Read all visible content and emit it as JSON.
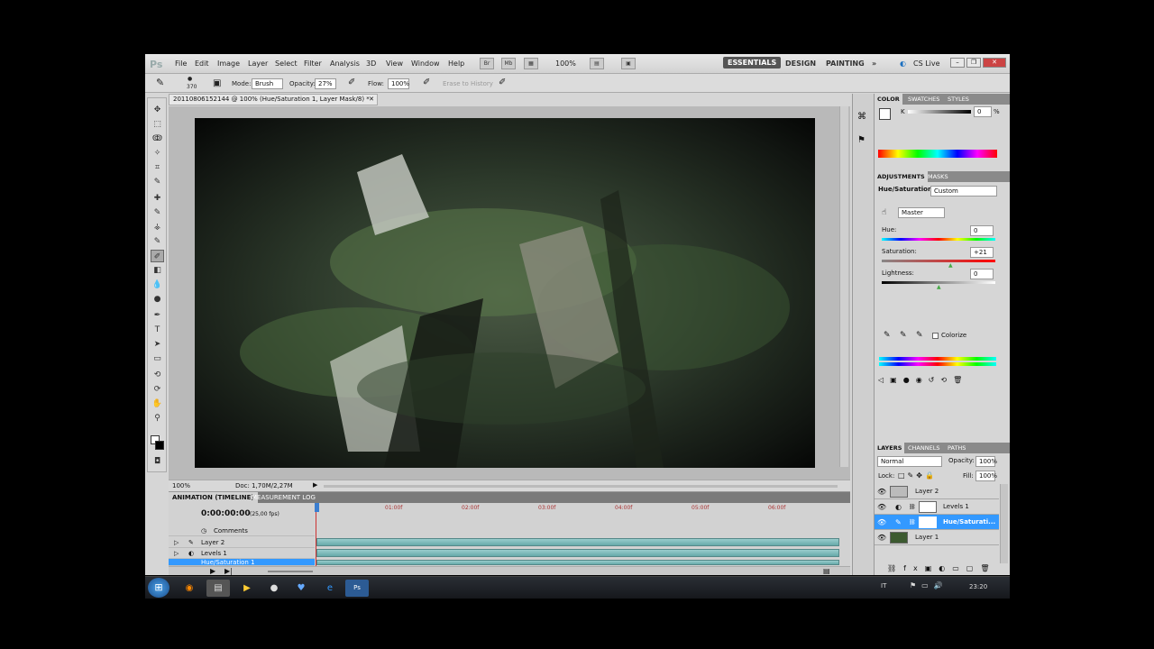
{
  "menubar": {
    "logo": "Ps",
    "menus": [
      "File",
      "Edit",
      "Image",
      "Layer",
      "Select",
      "Filter",
      "Analysis",
      "3D",
      "View",
      "Window",
      "Help"
    ],
    "zoom": "100%",
    "workspaces": [
      "ESSENTIALS",
      "DESIGN",
      "PAINTING"
    ],
    "cslive": "CS Live"
  },
  "options": {
    "brush_size": "370",
    "mode_label": "Mode:",
    "mode_value": "Brush",
    "opacity_label": "Opacity:",
    "opacity_value": "27%",
    "flow_label": "Flow:",
    "flow_value": "100%",
    "erase_history": "Erase to History"
  },
  "document": {
    "tab_title": "20110806152144 @ 100% (Hue/Saturation 1, Layer Mask/8) *",
    "status_zoom": "100%",
    "status_doc": "Doc: 1,70M/2,27M"
  },
  "timeline": {
    "tabs": [
      "ANIMATION (TIMELINE)",
      "MEASUREMENT LOG"
    ],
    "timecode": "0:00:00:00",
    "fps": "(25,00 fps)",
    "markers": [
      "01:00f",
      "02:00f",
      "03:00f",
      "04:00f",
      "05:00f",
      "06:00f"
    ],
    "rows": [
      "Comments",
      "Layer 2",
      "Levels 1",
      "Hue/Saturation 1"
    ]
  },
  "color_panel": {
    "tabs": [
      "COLOR",
      "SWATCHES",
      "STYLES"
    ],
    "channel": "K",
    "value": "0",
    "unit": "%"
  },
  "adjustments": {
    "tabs": [
      "ADJUSTMENTS",
      "MASKS"
    ],
    "title": "Hue/Saturation",
    "preset": "Custom",
    "range": "Master",
    "hue_label": "Hue:",
    "hue_value": "0",
    "saturation_label": "Saturation:",
    "saturation_value": "+21",
    "lightness_label": "Lightness:",
    "lightness_value": "0",
    "colorize": "Colorize"
  },
  "layers_panel": {
    "tabs": [
      "LAYERS",
      "CHANNELS",
      "PATHS"
    ],
    "blend_mode": "Normal",
    "opacity_label": "Opacity:",
    "opacity_value": "100%",
    "lock_label": "Lock:",
    "fill_label": "Fill:",
    "fill_value": "100%",
    "layers": [
      "Layer 2",
      "Levels 1",
      "Hue/Saturati...",
      "Layer 1"
    ]
  },
  "taskbar": {
    "lang": "IT",
    "clock": "23:20"
  },
  "colors": {
    "selection_blue": "#3399ff",
    "workspace_active": "#555555",
    "track_teal": "#6aa9a9"
  }
}
